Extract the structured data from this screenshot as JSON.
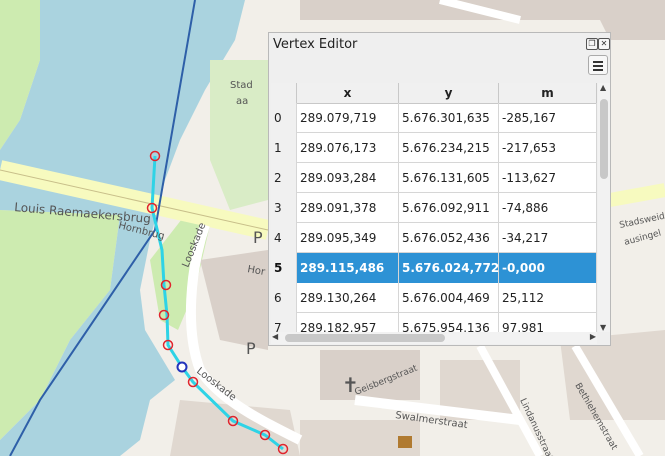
{
  "window": {
    "title": "Vertex Editor"
  },
  "icons": {
    "restore": "restore-icon",
    "close": "close-icon",
    "menu": "hamburger-menu-icon"
  },
  "table": {
    "columns": [
      "x",
      "y",
      "m"
    ],
    "rows": [
      {
        "index": "0",
        "x": "289.079,719",
        "y": "5.676.301,635",
        "m": "-285,167"
      },
      {
        "index": "1",
        "x": "289.076,173",
        "y": "5.676.234,215",
        "m": "-217,653"
      },
      {
        "index": "2",
        "x": "289.093,284",
        "y": "5.676.131,605",
        "m": "-113,627"
      },
      {
        "index": "3",
        "x": "289.091,378",
        "y": "5.676.092,911",
        "m": "-74,886"
      },
      {
        "index": "4",
        "x": "289.095,349",
        "y": "5.676.052,436",
        "m": "-34,217"
      },
      {
        "index": "5",
        "x": "289.115,486",
        "y": "5.676.024,772",
        "m": "-0,000"
      },
      {
        "index": "6",
        "x": "289.130,264",
        "y": "5.676.004,469",
        "m": "25,112"
      },
      {
        "index": "7",
        "x": "289.182,957",
        "y": "5.675.954,136",
        "m": "97,981"
      }
    ],
    "selected_row": "5"
  },
  "map": {
    "labels": {
      "bridge": "Louis Raemaekersbrug",
      "horn": "Hornbrug",
      "looskade": "Looskade",
      "looskade2": "Looskade",
      "swalmerstraat": "Swalmerstraat",
      "lindanusstraat": "Lindanusstraat",
      "bethlehemstraat": "Bethlehemstraat",
      "geisbergstraat": "Geisbergstraat",
      "stadsweide": "Stadsweide",
      "kleine": "ausingel",
      "stad": "Stad",
      "aa": "aa",
      "hor": "Hor",
      "parking1": "P",
      "parking2": "P"
    },
    "colors": {
      "water": "#aad3df",
      "green": "#cdebb0",
      "road": "#f7fabf",
      "route": "#2ed3e6",
      "vertex": "#e0242d"
    }
  }
}
